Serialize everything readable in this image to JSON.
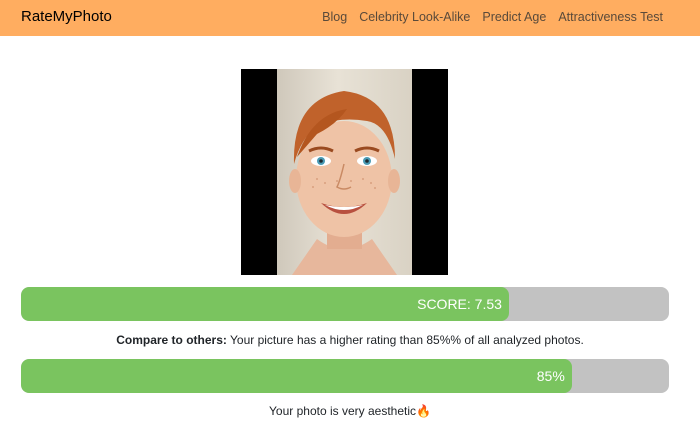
{
  "navbar": {
    "brand": "RateMyPhoto",
    "links": [
      "Blog",
      "Celebrity Look-Alike",
      "Predict Age",
      "Attractiveness Test"
    ]
  },
  "score": {
    "label": "SCORE: 7.53",
    "value": 7.53,
    "fraction": 0.753
  },
  "compare": {
    "label": "Compare to others:",
    "text": " Your picture has a higher rating than 85%% of all analyzed photos."
  },
  "percentile": {
    "label": "85%",
    "fraction": 0.85
  },
  "verdict": {
    "text": "Your photo is very aesthetic",
    "emoji": "🔥"
  },
  "colors": {
    "navbar": "#ffad60",
    "bar_fill": "#7ac45f",
    "bar_track": "#c2c2c2"
  }
}
